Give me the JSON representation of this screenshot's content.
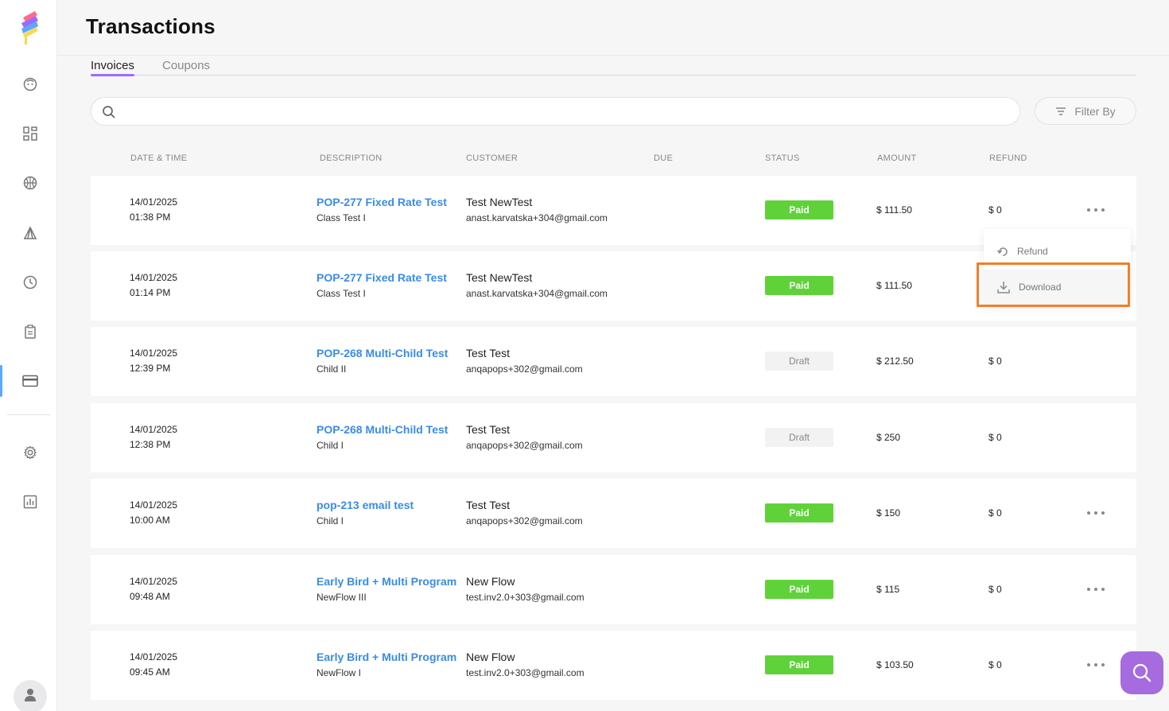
{
  "page": {
    "title": "Transactions"
  },
  "tabs": [
    {
      "label": "Invoices",
      "active": true
    },
    {
      "label": "Coupons",
      "active": false
    }
  ],
  "search": {
    "placeholder": "",
    "value": ""
  },
  "filter": {
    "label": "Filter By"
  },
  "columns": [
    "DATE & TIME",
    "DESCRIPTION",
    "CUSTOMER",
    "DUE",
    "STATUS",
    "AMOUNT",
    "REFUND"
  ],
  "rows": [
    {
      "date": "14/01/2025",
      "time": "01:38 PM",
      "title": "POP-277 Fixed Rate Test",
      "subtitle": "Class Test I",
      "customer": "Test NewTest",
      "email": "anast.karvatska+304@gmail.com",
      "status": "Paid",
      "amount": "$ 111.50",
      "refund": "$ 0"
    },
    {
      "date": "14/01/2025",
      "time": "01:14 PM",
      "title": "POP-277 Fixed Rate Test",
      "subtitle": "Class Test I",
      "customer": "Test NewTest",
      "email": "anast.karvatska+304@gmail.com",
      "status": "Paid",
      "amount": "$ 111.50",
      "refund": ""
    },
    {
      "date": "14/01/2025",
      "time": "12:39 PM",
      "title": "POP-268 Multi-Child Test",
      "subtitle": "Child II",
      "customer": "Test Test",
      "email": "anqapops+302@gmail.com",
      "status": "Draft",
      "amount": "$ 212.50",
      "refund": "$ 0"
    },
    {
      "date": "14/01/2025",
      "time": "12:38 PM",
      "title": "POP-268 Multi-Child Test",
      "subtitle": "Child I",
      "customer": "Test Test",
      "email": "anqapops+302@gmail.com",
      "status": "Draft",
      "amount": "$ 250",
      "refund": "$ 0"
    },
    {
      "date": "14/01/2025",
      "time": "10:00 AM",
      "title": "pop-213 email test",
      "subtitle": "Child I",
      "customer": "Test Test",
      "email": "anqapops+302@gmail.com",
      "status": "Paid",
      "amount": "$ 150",
      "refund": "$ 0"
    },
    {
      "date": "14/01/2025",
      "time": "09:48 AM",
      "title": "Early Bird + Multi Program",
      "subtitle": "NewFlow III",
      "customer": "New Flow",
      "email": "test.inv2.0+303@gmail.com",
      "status": "Paid",
      "amount": "$ 115",
      "refund": "$ 0"
    },
    {
      "date": "14/01/2025",
      "time": "09:45 AM",
      "title": "Early Bird + Multi Program",
      "subtitle": "NewFlow I",
      "customer": "New Flow",
      "email": "test.inv2.0+303@gmail.com",
      "status": "Paid",
      "amount": "$ 103.50",
      "refund": "$ 0"
    }
  ],
  "dropdown": {
    "refund_label": "Refund",
    "download_label": "Download"
  },
  "colors": {
    "paid": "#5fd23a",
    "link": "#3a8be8",
    "accent": "#9b6cff",
    "highlight": "#f07f2a",
    "fab": "#a56bdf"
  }
}
